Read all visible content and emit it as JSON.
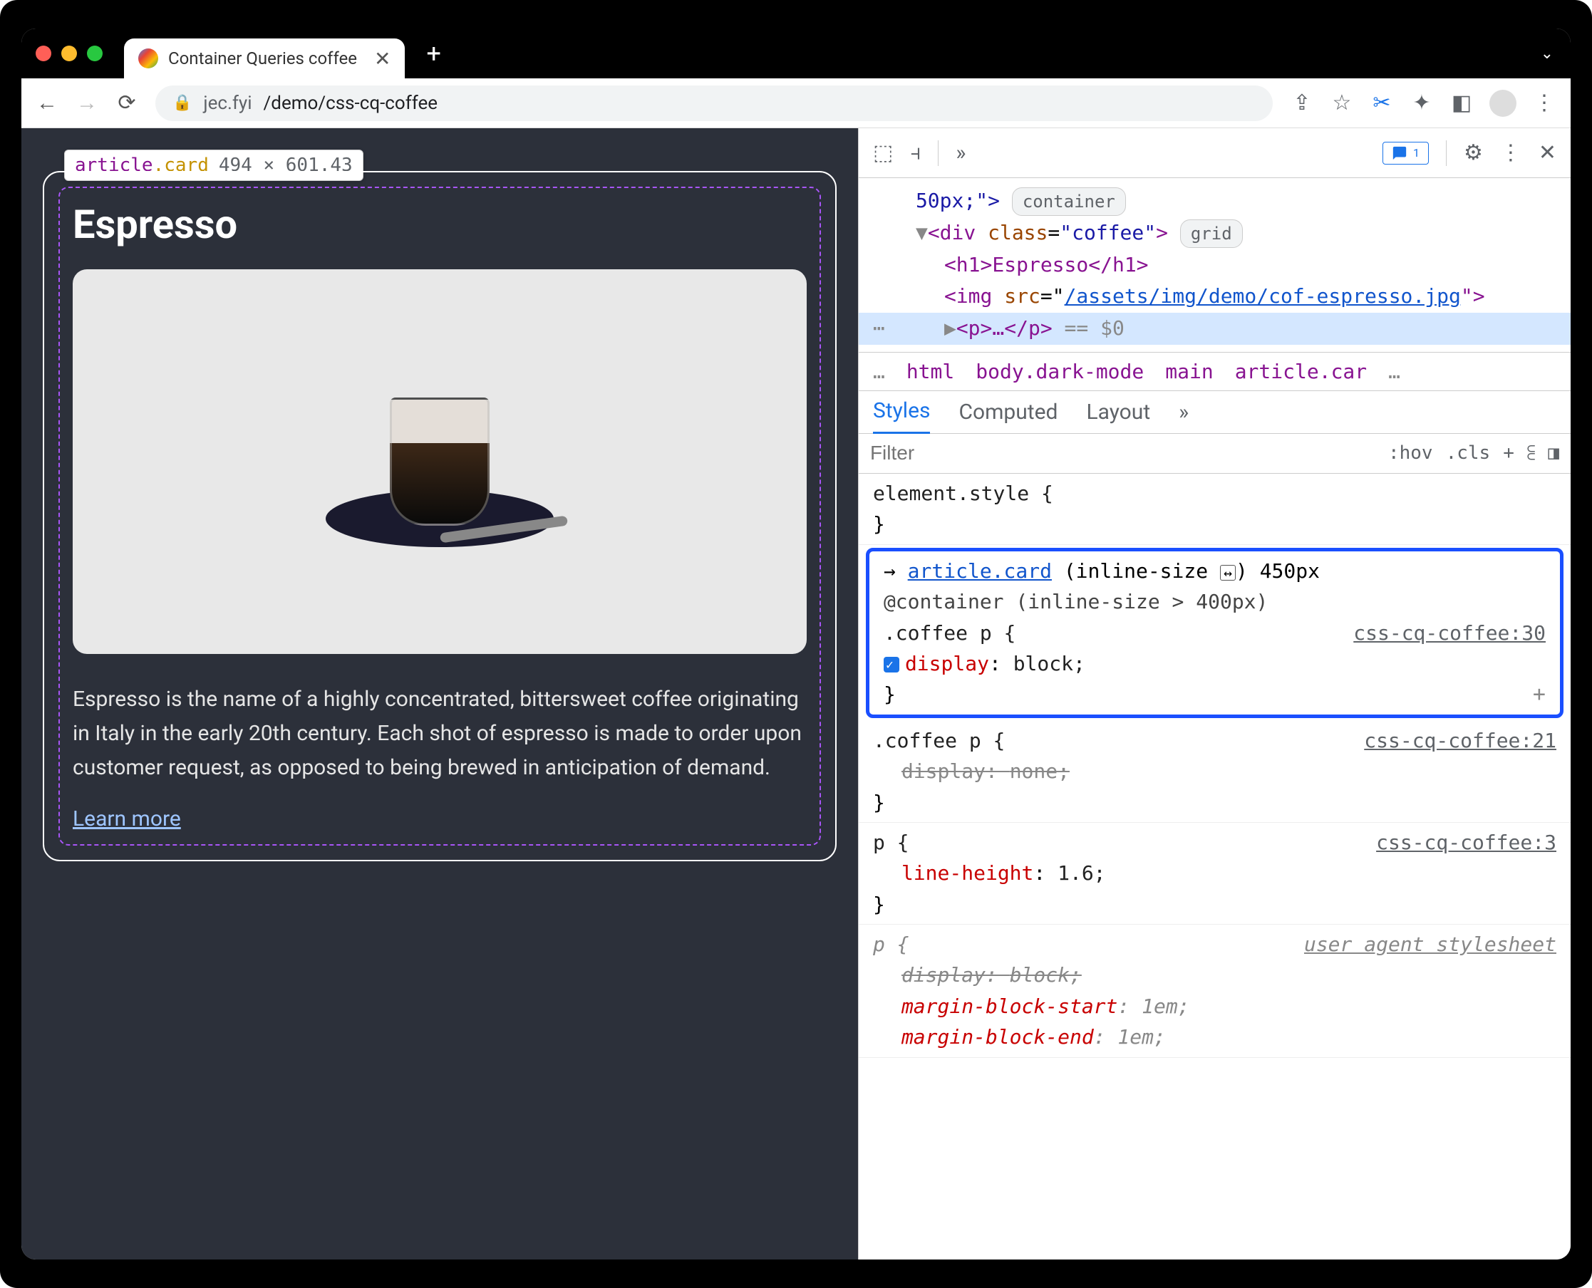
{
  "browser": {
    "tab_title": "Container Queries coffee",
    "url_host": "jec.fyi",
    "url_path": "/demo/css-cq-coffee"
  },
  "tooltip": {
    "element": "article",
    "class": ".card",
    "dimensions": "494 × 601.43"
  },
  "page": {
    "heading": "Espresso",
    "description": "Espresso is the name of a highly concentrated, bittersweet coffee originating in Italy in the early 20th century. Each shot of espresso is made to order upon customer request, as opposed to being brewed in anticipation of demand.",
    "link_text": "Learn more"
  },
  "devtools": {
    "issues_count": "1",
    "dom": {
      "l1": "50px;\">",
      "pill1": "container",
      "l2_open": "<div ",
      "l2_attr": "class",
      "l2_val": "\"coffee\"",
      "l2_close": ">",
      "pill2": "grid",
      "l3": "<h1>Espresso</h1>",
      "l4a": "<img ",
      "l4_attr": "src",
      "l4_link": "/assets/img/demo/cof-espresso.jpg",
      "l4c": "\">",
      "l5": "<p>…</p>",
      "l5_eq": " == $0"
    },
    "breadcrumbs": [
      "html",
      "body.dark-mode",
      "main",
      "article.car"
    ],
    "tabs": [
      "Styles",
      "Computed",
      "Layout"
    ],
    "filter_placeholder": "Filter",
    "filter_buttons": [
      ":hov",
      ".cls"
    ],
    "rules": {
      "element_style": "element.style {",
      "r1": {
        "container_sel": "article.card",
        "container_info": " (inline-size ",
        "container_px": ") 450px",
        "at": "@container (inline-size > 400px)",
        "sel": ".coffee p {",
        "src": "css-cq-coffee:30",
        "prop": "display",
        "val": "block;"
      },
      "r2": {
        "sel": ".coffee p {",
        "src": "css-cq-coffee:21",
        "prop": "display",
        "val": "none;"
      },
      "r3": {
        "sel": "p {",
        "src": "css-cq-coffee:3",
        "prop": "line-height",
        "val": "1.6;"
      },
      "r4": {
        "sel": "p {",
        "src": "user agent stylesheet",
        "p1": "display",
        "v1": "block;",
        "p2": "margin-block-start",
        "v2": "1em;",
        "p3": "margin-block-end",
        "v3": "1em;"
      }
    }
  }
}
